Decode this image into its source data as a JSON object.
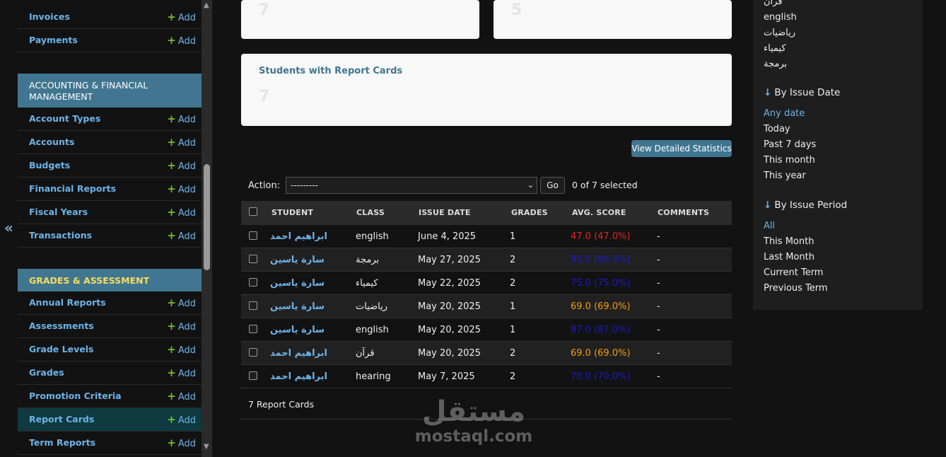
{
  "sidebar": {
    "collapse_glyph": "«",
    "add_label": "Add",
    "sections": [
      {
        "items": [
          {
            "label": "Invoices"
          },
          {
            "label": "Payments"
          }
        ]
      },
      {
        "title": "ACCOUNTING & FINANCIAL MANAGEMENT",
        "items": [
          {
            "label": "Account Types"
          },
          {
            "label": "Accounts"
          },
          {
            "label": "Budgets"
          },
          {
            "label": "Financial Reports"
          },
          {
            "label": "Fiscal Years"
          },
          {
            "label": "Transactions"
          }
        ]
      },
      {
        "title": "GRADES & ASSESSMENT",
        "items": [
          {
            "label": "Annual Reports"
          },
          {
            "label": "Assessments"
          },
          {
            "label": "Grade Levels"
          },
          {
            "label": "Grades"
          },
          {
            "label": "Promotion Criteria"
          },
          {
            "label": "Report Cards",
            "active": true
          },
          {
            "label": "Term Reports"
          }
        ]
      }
    ]
  },
  "summary_cards": [
    {
      "value": "7"
    },
    {
      "value": "5"
    },
    {
      "title": "Students with Report Cards",
      "value": "7"
    }
  ],
  "stats_button": "View Detailed Statistics",
  "actions": {
    "label": "Action:",
    "selected_option": "---------",
    "go_label": "Go",
    "selected_count": "0 of 7 selected"
  },
  "table": {
    "columns": [
      "STUDENT",
      "CLASS",
      "ISSUE DATE",
      "GRADES",
      "AVG. SCORE",
      "COMMENTS"
    ],
    "rows": [
      {
        "student": "ابراهيم احمد",
        "class": "english",
        "issue_date": "June 4, 2025",
        "grades": "1",
        "avg_score": "47.0 (47.0%)",
        "score_color": "#e02424",
        "comments": "-"
      },
      {
        "student": "سارة ياسين",
        "class": "برمجة",
        "issue_date": "May 27, 2025",
        "grades": "2",
        "avg_score": "80.5 (80.5%)",
        "score_color": "#1a1acc",
        "comments": "-"
      },
      {
        "student": "سارة ياسين",
        "class": "كيمياء",
        "issue_date": "May 22, 2025",
        "grades": "2",
        "avg_score": "75.0 (75.0%)",
        "score_color": "#1a1acc",
        "comments": "-"
      },
      {
        "student": "سارة ياسين",
        "class": "رياضيات",
        "issue_date": "May 20, 2025",
        "grades": "1",
        "avg_score": "69.0 (69.0%)",
        "score_color": "#f39c12",
        "comments": "-"
      },
      {
        "student": "سارة ياسين",
        "class": "english",
        "issue_date": "May 20, 2025",
        "grades": "1",
        "avg_score": "87.0 (87.0%)",
        "score_color": "#1a1acc",
        "comments": "-"
      },
      {
        "student": "ابراهيم احمد",
        "class": "قرآن",
        "issue_date": "May 20, 2025",
        "grades": "2",
        "avg_score": "69.0 (69.0%)",
        "score_color": "#f39c12",
        "comments": "-"
      },
      {
        "student": "ابراهيم احمد",
        "class": "hearing",
        "issue_date": "May 7, 2025",
        "grades": "2",
        "avg_score": "70.0 (70.0%)",
        "score_color": "#1a1acc",
        "comments": "-"
      }
    ],
    "footer": "7 Report Cards"
  },
  "filter": {
    "class_items": [
      "قرآن",
      "english",
      "رياضيات",
      "كيمياء",
      "برمجة"
    ],
    "by_issue_date": {
      "title": "By Issue Date",
      "items": [
        "Any date",
        "Today",
        "Past 7 days",
        "This month",
        "This year"
      ],
      "selected": 0
    },
    "by_issue_period": {
      "title": "By Issue Period",
      "items": [
        "All",
        "This Month",
        "Last Month",
        "Current Term",
        "Previous Term"
      ],
      "selected": 0
    },
    "arrow_glyph": "↓"
  },
  "watermark": {
    "logo": "مستقل",
    "url": "mostaql.com"
  }
}
